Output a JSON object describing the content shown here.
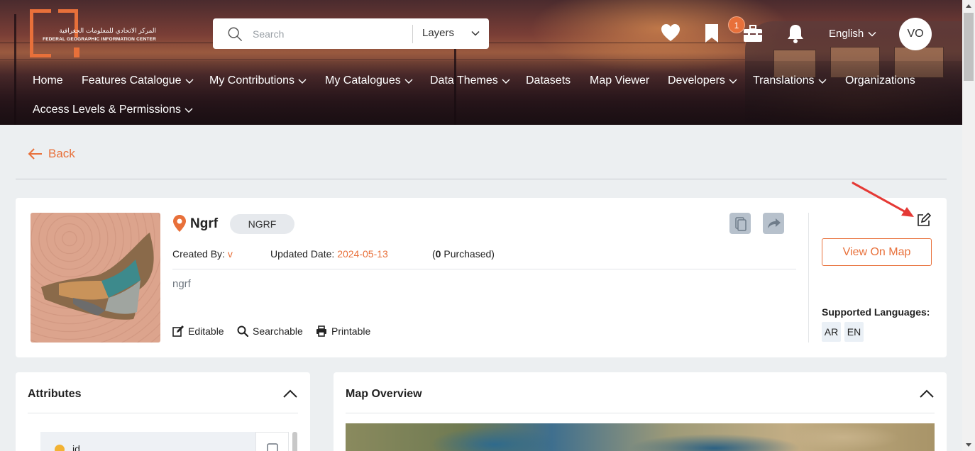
{
  "header": {
    "logo": {
      "arabic_text": "المركز الاتحادي للمعلومات الجغرافية",
      "english_text": "FEDERAL GEOGRAPHIC INFORMATION CENTER"
    },
    "search": {
      "placeholder": "Search",
      "scope_label": "Layers"
    },
    "icons": [
      "heart-icon",
      "bookmark-icon",
      "toolbox-icon",
      "bell-icon"
    ],
    "cart_badge_count": "1",
    "language": "English",
    "avatar_initials": "VO"
  },
  "nav": {
    "items": [
      {
        "label": "Home"
      },
      {
        "label": "Features Catalogue"
      },
      {
        "label": "My Contributions"
      },
      {
        "label": "My Catalogues"
      },
      {
        "label": "Data Themes"
      },
      {
        "label": "Datasets"
      },
      {
        "label": "Map Viewer"
      },
      {
        "label": "Developers"
      },
      {
        "label": "Translations"
      },
      {
        "label": "Organizations"
      },
      {
        "label": "Access Levels & Permissions"
      }
    ]
  },
  "back_label": "Back",
  "item": {
    "title": "Ngrf",
    "code": "NGRF",
    "created_by_label": "Created By:",
    "created_by_value": "v",
    "updated_date_label": "Updated Date:",
    "updated_date_value": "2024-05-13",
    "purchased_open": "(",
    "purchased_count": "0",
    "purchased_close": " Purchased)",
    "description": "ngrf",
    "capabilities": [
      "Editable",
      "Searchable",
      "Printable"
    ],
    "view_on_map_label": "View On Map",
    "supported_languages_label": "Supported Languages:",
    "languages": [
      "AR",
      "EN"
    ]
  },
  "panels": {
    "attributes": {
      "title": "Attributes",
      "first_attribute": "id"
    },
    "map_overview": {
      "title": "Map Overview"
    }
  },
  "colors": {
    "accent": "#e8703a",
    "page_bg": "#eceff1",
    "chip_bg": "#e6e9ed",
    "annotation_arrow": "#e53935"
  }
}
